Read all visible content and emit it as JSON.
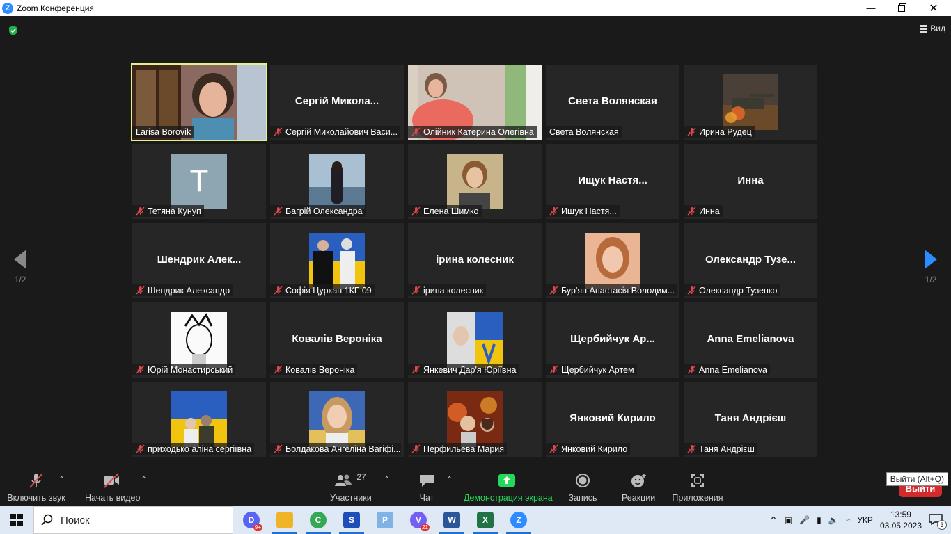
{
  "window": {
    "title": "Zoom Конференция",
    "minimize_icon": "minimize-icon",
    "maximize_icon": "maximize-icon",
    "close_icon": "close-icon"
  },
  "view_button": {
    "label": "Вид"
  },
  "pager": {
    "left": "1/2",
    "right": "1/2"
  },
  "participants": [
    {
      "name": "Larisa Borovik",
      "display": "",
      "muted": false,
      "active": true,
      "video": "larisa"
    },
    {
      "name": "Сергій Миколайович Васи...",
      "display": "Сергій  Микола...",
      "muted": true
    },
    {
      "name": "Олійник Катерина Олегівна",
      "display": "",
      "muted": true,
      "video": "kateryna"
    },
    {
      "name": "Света Волянская",
      "display": "Света Волянская",
      "muted": false
    },
    {
      "name": "Ирина Рудец",
      "display": "",
      "muted": true,
      "avatar": "tank"
    },
    {
      "name": "Тетяна Кунуп",
      "display": "",
      "muted": true,
      "avatar": "letter",
      "letter": "T"
    },
    {
      "name": "Багрій Олександра",
      "display": "",
      "muted": true,
      "avatar": "sea"
    },
    {
      "name": "Елена Шимко",
      "display": "",
      "muted": true,
      "avatar": "woman"
    },
    {
      "name": "Ищук Настя...",
      "display": "Ищук Настя...",
      "muted": true
    },
    {
      "name": "Инна",
      "display": "Инна",
      "muted": true
    },
    {
      "name": "Шендрик Александр",
      "display": "Шендрик  Алек...",
      "muted": true
    },
    {
      "name": "Софія Цуркан 1КГ-09",
      "display": "",
      "muted": true,
      "avatar": "flag_people"
    },
    {
      "name": "ірина колесник",
      "display": "ірина колесник",
      "muted": true
    },
    {
      "name": "Бур'ян Анастасія Володим...",
      "display": "",
      "muted": true,
      "avatar": "girl"
    },
    {
      "name": "Олександр Тузенко",
      "display": "Олександр  Тузе...",
      "muted": true
    },
    {
      "name": "Юрій Монастирський",
      "display": "",
      "muted": true,
      "avatar": "manga"
    },
    {
      "name": "Ковалів Вероніка",
      "display": "Ковалів Вероніка",
      "muted": true
    },
    {
      "name": "Янкевич Дар'я Юріївна",
      "display": "",
      "muted": true,
      "avatar": "flag_girl"
    },
    {
      "name": "Щербийчук Артем",
      "display": "Щербийчук  Ар...",
      "muted": true
    },
    {
      "name": "Anna Emelianova",
      "display": "Anna Emelianova",
      "muted": true
    },
    {
      "name": "приходько аліна сергіївна",
      "display": "",
      "muted": true,
      "avatar": "flag_pair"
    },
    {
      "name": "Болдакова Ангеліна Вагіфі...",
      "display": "",
      "muted": true,
      "avatar": "blonde"
    },
    {
      "name": "Перфильева Мария",
      "display": "",
      "muted": true,
      "avatar": "fire"
    },
    {
      "name": "Янковий Кирило",
      "display": "Янковий Кирило",
      "muted": true
    },
    {
      "name": "Таня Андрієш",
      "display": "Таня Андрієш",
      "muted": true
    }
  ],
  "toolbar": {
    "audio": "Включить звук",
    "video": "Начать видео",
    "participants": "Участники",
    "participants_count": "27",
    "chat": "Чат",
    "share": "Демонстрация экрана",
    "record": "Запись",
    "reactions": "Реакции",
    "apps": "Приложения",
    "leave": "Выйти",
    "leave_tooltip": "Выйти (Alt+Q)"
  },
  "taskbar": {
    "search_placeholder": "Поиск",
    "apps": [
      {
        "icon": "discord-icon",
        "color": "#5865f2",
        "badge": "9+"
      },
      {
        "icon": "file-explorer-icon",
        "color": "#f0b429",
        "badge": ""
      },
      {
        "icon": "chrome-icon",
        "color": "#34a853",
        "badge": ""
      },
      {
        "icon": "save-app-icon",
        "color": "#1e4fb8",
        "badge": ""
      },
      {
        "icon": "paint-icon",
        "color": "#7fb2e5",
        "badge": ""
      },
      {
        "icon": "viber-icon",
        "color": "#7360f2",
        "badge": "21"
      },
      {
        "icon": "word-icon",
        "color": "#2b579a",
        "badge": ""
      },
      {
        "icon": "excel-icon",
        "color": "#217346",
        "badge": ""
      },
      {
        "icon": "zoom-icon",
        "color": "#2d8cff",
        "badge": ""
      }
    ],
    "lang": "УКР",
    "time": "13:59",
    "date": "03.05.2023",
    "notifications": "3"
  },
  "colors": {
    "active_speaker": "#e4f08a",
    "share_green": "#23d959",
    "leave_red": "#d32b2b",
    "muted_red": "#e0484f"
  }
}
